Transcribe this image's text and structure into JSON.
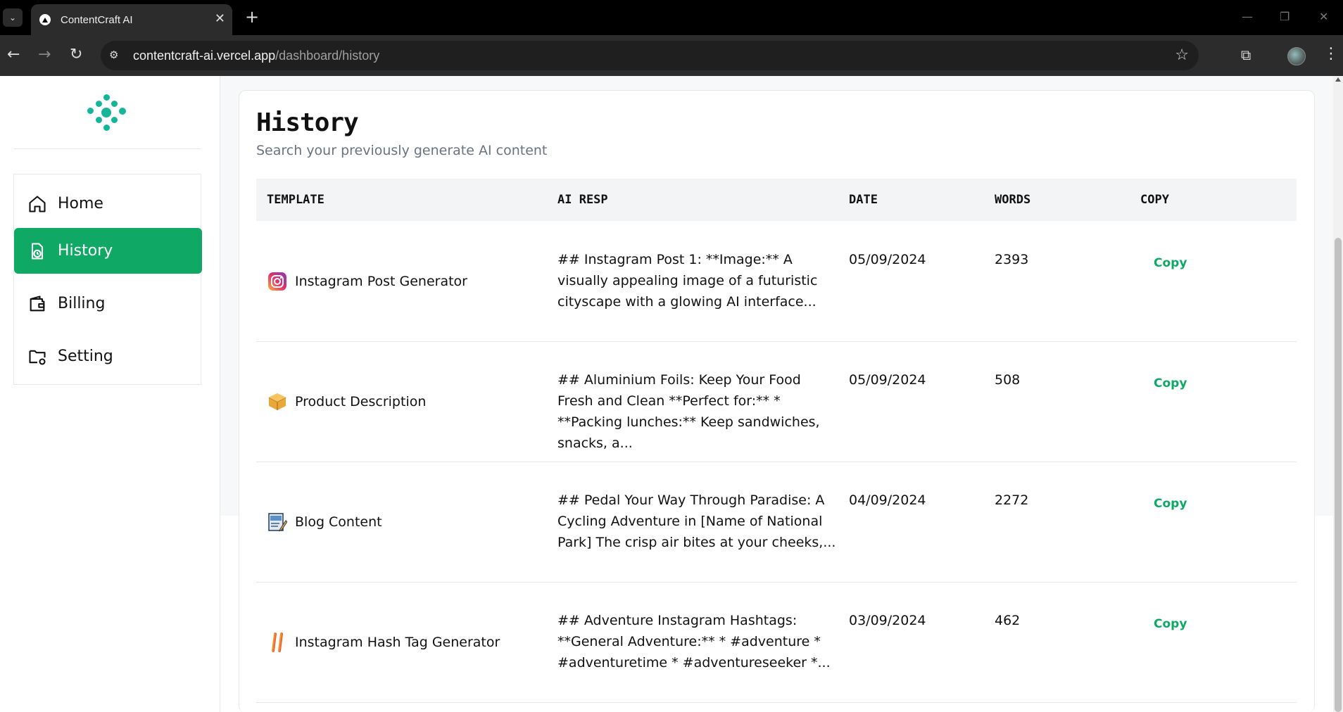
{
  "browser": {
    "tab_title": "ContentCraft AI",
    "url_host": "contentcraft-ai.vercel.app",
    "url_path": "/dashboard/history"
  },
  "sidebar": {
    "items": [
      {
        "label": "Home",
        "icon": "home-icon",
        "active": false
      },
      {
        "label": "History",
        "icon": "history-icon",
        "active": true
      },
      {
        "label": "Billing",
        "icon": "wallet-icon",
        "active": false
      },
      {
        "label": "Setting",
        "icon": "folder-settings-icon",
        "active": false
      }
    ]
  },
  "page": {
    "title": "History",
    "subtitle": "Search your previously generate AI content"
  },
  "table": {
    "headers": {
      "template": "TEMPLATE",
      "ai_resp": "AI RESP",
      "date": "DATE",
      "words": "WORDS",
      "copy": "COPY"
    },
    "rows": [
      {
        "icon": "instagram-icon",
        "template": "Instagram Post Generator",
        "ai_resp": "## Instagram Post 1: **Image:** A visually appealing image of a futuristic cityscape with a glowing AI interface...",
        "date": "05/09/2024",
        "words": "2393",
        "copy": "Copy"
      },
      {
        "icon": "package-icon",
        "template": "Product Description",
        "ai_resp": "## Aluminium Foils: Keep Your Food Fresh and Clean **Perfect for:** * **Packing lunches:** Keep sandwiches, snacks, a...",
        "date": "05/09/2024",
        "words": "508",
        "copy": "Copy"
      },
      {
        "icon": "blog-icon",
        "template": "Blog Content",
        "ai_resp": "## Pedal Your Way Through Paradise: A Cycling Adventure in [Name of National Park] The crisp air bites at your cheeks,...",
        "date": "04/09/2024",
        "words": "2272",
        "copy": "Copy"
      },
      {
        "icon": "hashtag-icon",
        "template": "Instagram Hash Tag Generator",
        "ai_resp": "## Adventure Instagram Hashtags: **General Adventure:** * #adventure * #adventuretime * #adventureseeker *...",
        "date": "03/09/2024",
        "words": "462",
        "copy": "Copy"
      }
    ]
  },
  "colors": {
    "accent": "#0fa865",
    "logo": "#16b59a"
  }
}
